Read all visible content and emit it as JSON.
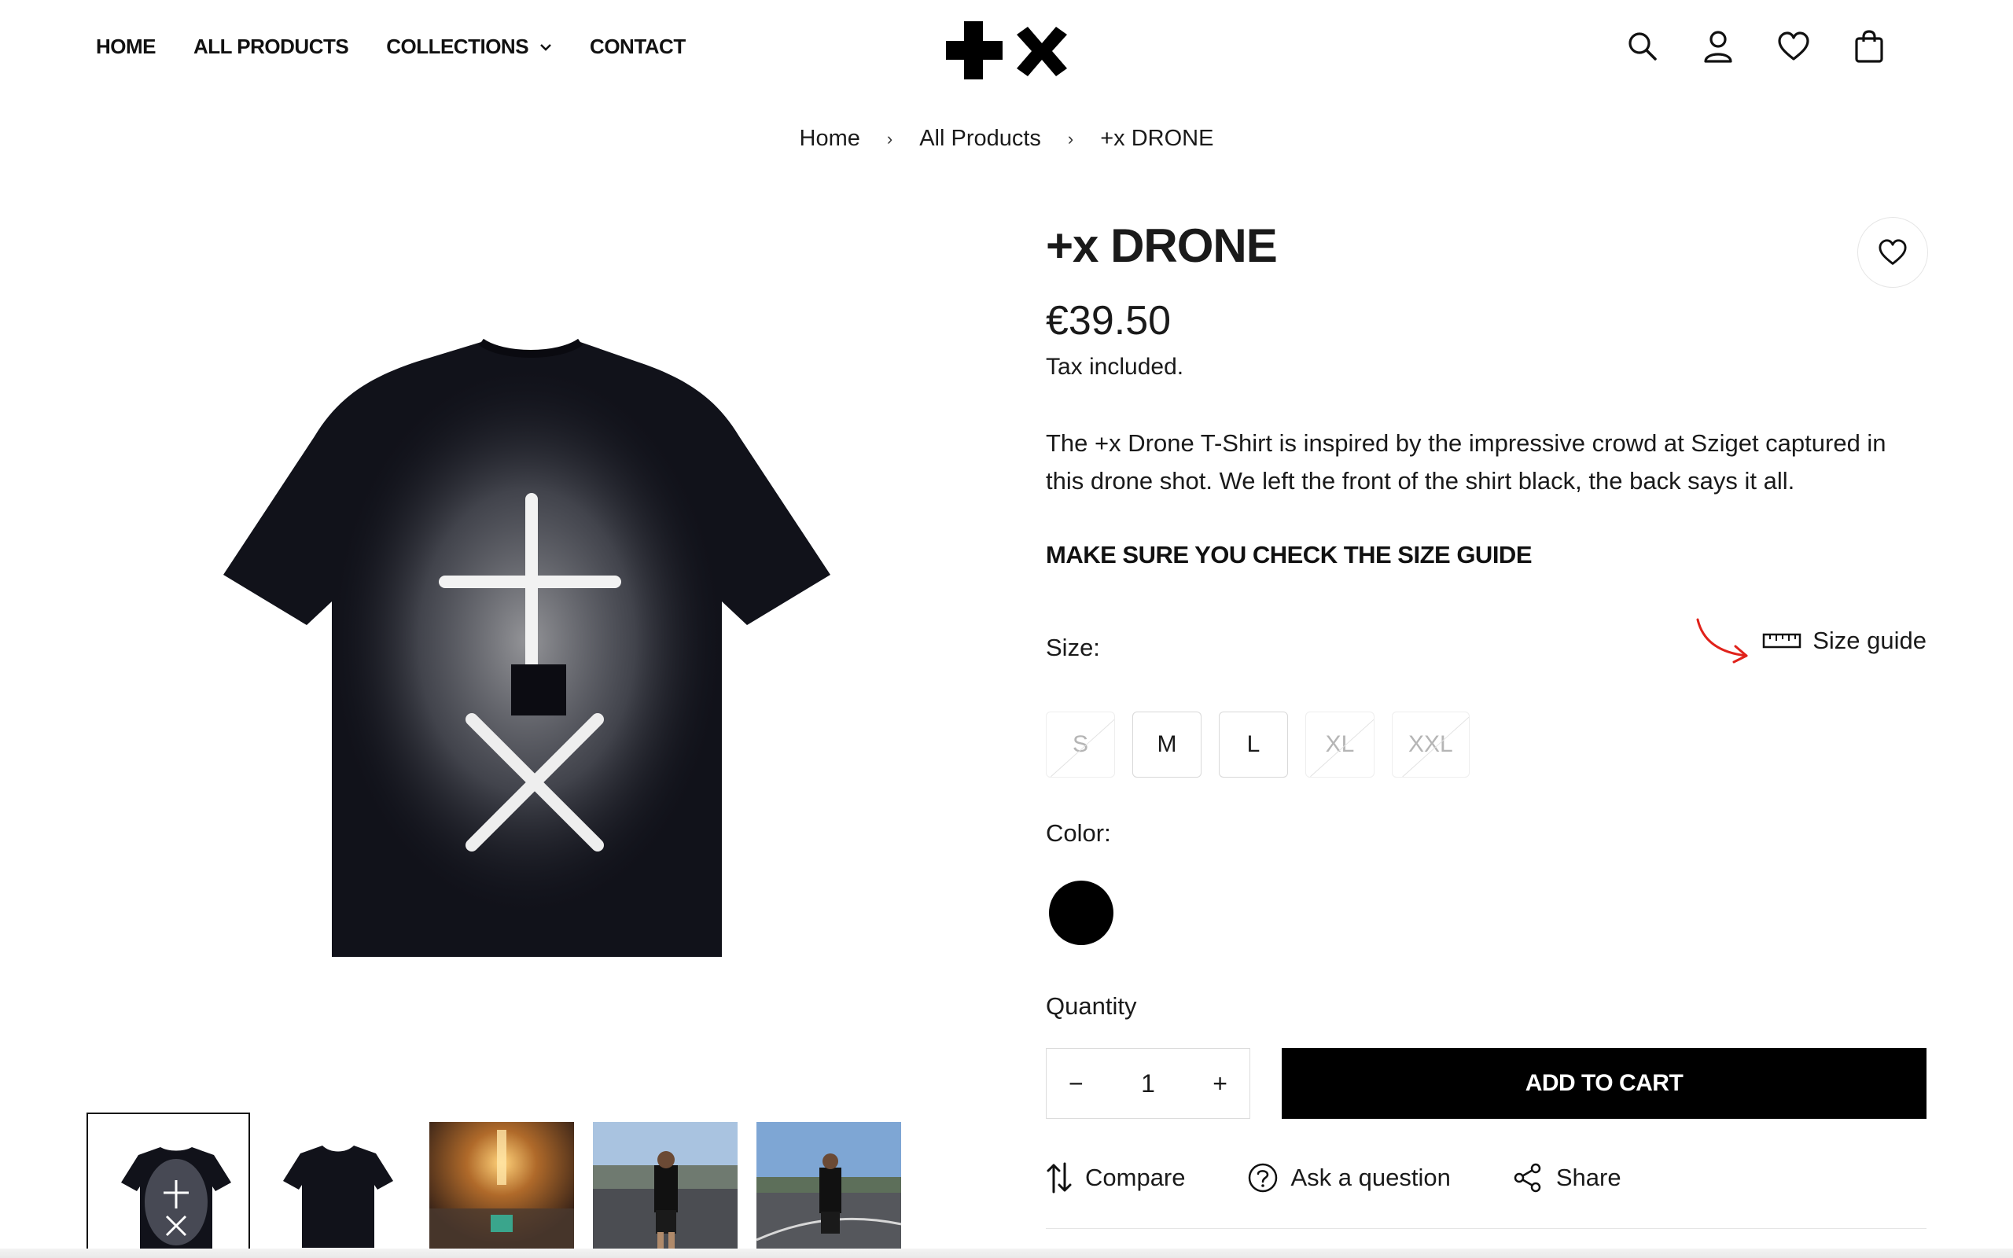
{
  "nav": {
    "items": [
      {
        "label": "HOME"
      },
      {
        "label": "ALL PRODUCTS"
      },
      {
        "label": "COLLECTIONS"
      },
      {
        "label": "CONTACT"
      }
    ]
  },
  "breadcrumb": {
    "items": [
      "Home",
      "All Products",
      "+x DRONE"
    ],
    "separator": "›"
  },
  "product": {
    "title": "+x DRONE",
    "price": "€39.50",
    "tax_note": "Tax included.",
    "description": "The +x Drone T-Shirt is inspired by the impressive crowd at Sziget captured in this drone shot. We left the front of the shirt black, the back says it all.",
    "notice": "MAKE SURE YOU CHECK THE SIZE GUIDE",
    "size_label": "Size:",
    "size_guide_label": "Size guide",
    "sizes": [
      {
        "label": "S",
        "available": false
      },
      {
        "label": "M",
        "available": true
      },
      {
        "label": "L",
        "available": true
      },
      {
        "label": "XL",
        "available": false
      },
      {
        "label": "XXL",
        "available": false
      }
    ],
    "color_label": "Color:",
    "color_swatch": "#000000",
    "quantity_label": "Quantity",
    "quantity": "1",
    "qty_minus": "−",
    "qty_plus": "+",
    "add_to_cart": "ADD TO CART",
    "actions": {
      "compare": "Compare",
      "ask": "Ask a question",
      "share": "Share"
    }
  },
  "colors": {
    "accent_arrow": "#e0221b",
    "button_bg": "#000000",
    "text": "#1a1a1a"
  }
}
